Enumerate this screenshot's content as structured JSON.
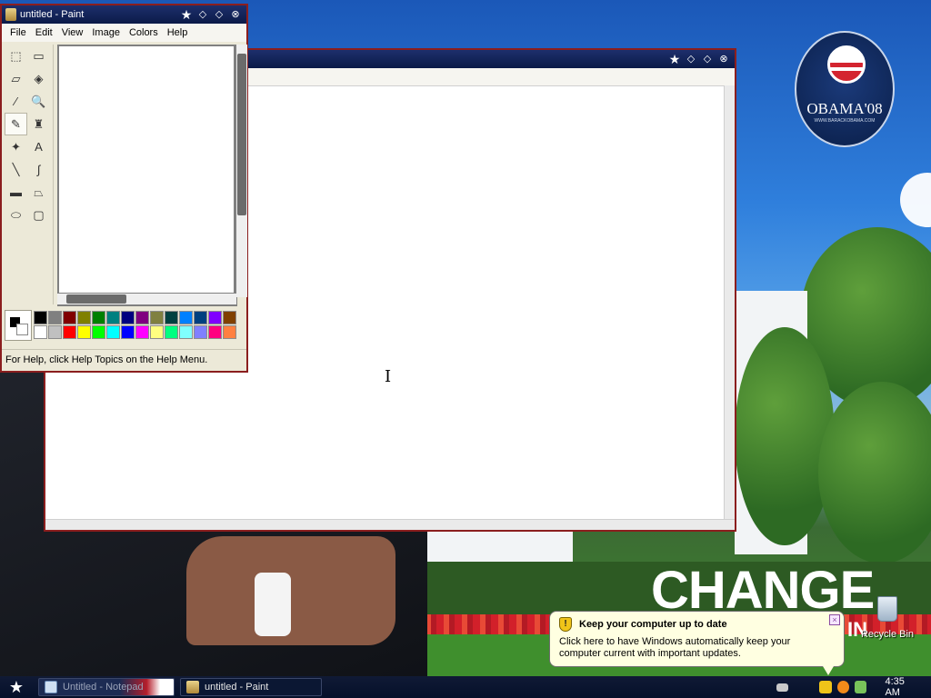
{
  "desktop": {
    "logo_text": "OBAMA'08",
    "logo_subtext": "WWW.BARACKOBAMA.COM",
    "slogan": "CHANGE",
    "slogan_suffix": "IN",
    "recycle_bin_label": "Recycle Bin"
  },
  "notepad": {
    "title": ""
  },
  "paint": {
    "title": "untitled - Paint",
    "menu": [
      "File",
      "Edit",
      "View",
      "Image",
      "Colors",
      "Help"
    ],
    "status": "For Help, click Help Topics on the Help Menu.",
    "tools": [
      {
        "name": "free-form-select-icon",
        "glyph": "⬚"
      },
      {
        "name": "select-icon",
        "glyph": "▭"
      },
      {
        "name": "eraser-icon",
        "glyph": "▱"
      },
      {
        "name": "fill-icon",
        "glyph": "◈"
      },
      {
        "name": "pick-color-icon",
        "glyph": "⁄"
      },
      {
        "name": "magnifier-icon",
        "glyph": "🔍"
      },
      {
        "name": "pencil-icon",
        "glyph": "✎"
      },
      {
        "name": "brush-icon",
        "glyph": "♜"
      },
      {
        "name": "airbrush-icon",
        "glyph": "✦"
      },
      {
        "name": "text-icon",
        "glyph": "A"
      },
      {
        "name": "line-icon",
        "glyph": "╲"
      },
      {
        "name": "curve-icon",
        "glyph": "∫"
      },
      {
        "name": "rectangle-icon",
        "glyph": "▬"
      },
      {
        "name": "polygon-icon",
        "glyph": "⏢"
      },
      {
        "name": "ellipse-icon",
        "glyph": "⬭"
      },
      {
        "name": "rounded-rectangle-icon",
        "glyph": "▢"
      }
    ],
    "selected_tool": 6,
    "palette_top": [
      "#000000",
      "#808080",
      "#800000",
      "#808000",
      "#008000",
      "#008080",
      "#000080",
      "#800080",
      "#808040",
      "#004040",
      "#0080ff",
      "#004080",
      "#8000ff",
      "#804000"
    ],
    "palette_bottom": [
      "#ffffff",
      "#c0c0c0",
      "#ff0000",
      "#ffff00",
      "#00ff00",
      "#00ffff",
      "#0000ff",
      "#ff00ff",
      "#ffff80",
      "#00ff80",
      "#80ffff",
      "#8080ff",
      "#ff0080",
      "#ff8040"
    ]
  },
  "balloon": {
    "title": "Keep your computer up to date",
    "body": "Click here to have Windows automatically keep your computer current with important updates."
  },
  "taskbar": {
    "tasks": [
      {
        "label": "Untitled - Notepad"
      },
      {
        "label": "untitled - Paint"
      }
    ],
    "clock": "4:35 AM"
  }
}
